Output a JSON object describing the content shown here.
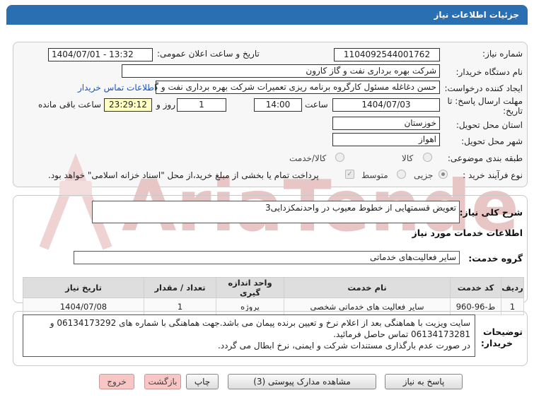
{
  "header": {
    "title": "جزئیات اطلاعات نیاز"
  },
  "form": {
    "need_number_label": "شماره نیاز:",
    "need_number": "1104092544001762",
    "announce_label": "تاریخ و ساعت اعلان عمومی:",
    "announce_value": "1404/07/01 - 13:32",
    "buyer_label": "نام دستگاه خریدار:",
    "buyer_value": "شرکت بهره برداری نفت و گاز کارون",
    "creator_label": "ایجاد کننده درخواست:",
    "creator_value": "حسن دغاغله مسئول کارگروه برنامه ریزی تعمیرات شرکت بهره برداری نفت و گاز",
    "contact_link": "اطلاعات تماس خریدار",
    "deadline_label_line1": "مهلت ارسال پاسخ: تا",
    "deadline_label_line2": "تاریخ:",
    "deadline_date": "1404/07/03",
    "time_label": "ساعت",
    "deadline_time": "14:00",
    "days_value": "1",
    "days_label": "روز و",
    "remaining_time": "23:29:12",
    "remaining_label": "ساعت باقی مانده",
    "province_label": "استان محل تحویل:",
    "province_value": "خوزستان",
    "city_label": "شهر محل تحویل:",
    "city_value": "اهواز",
    "category_label": "طبقه بندی موضوعی:",
    "category_options": [
      "کالا",
      "کالا/خدمت"
    ],
    "process_label": "نوع فرآیند خرید :",
    "process_options": [
      "جزیی",
      "متوسط"
    ],
    "payment_note": "پرداخت تمام یا بخشی از مبلغ خرید،از محل \"اسناد خزانه اسلامی\" خواهد بود."
  },
  "summary": {
    "label": "شرح کلی نیاز:",
    "value": "تعویض قسمتهایی از خطوط معیوب در واحدنمکزدایی3"
  },
  "services": {
    "section_title": "اطلاعات خدمات مورد نیاز",
    "group_label": "گروه خدمت:",
    "group_value": "سایر فعالیت‌های خدماتی"
  },
  "table": {
    "headers": [
      "ردیف",
      "کد خدمت",
      "نام خدمت",
      "واحد اندازه گیری",
      "تعداد / مقدار",
      "تاریخ نیاز"
    ],
    "rows": [
      [
        "1",
        "ط-96-960",
        "سایر فعالیت های خدماتی شخصی",
        "پروژه",
        "1",
        "1404/07/08"
      ]
    ]
  },
  "notes": {
    "label_line1": "توضیحات",
    "label_line2": "خریدار:",
    "line1": "سایت ویزیت با هماهنگی بعد از اعلام نرخ و تعیین برنده پیمان می باشد.جهت هماهنگی با شماره های  06134173292 و",
    "line2": "06134173281 تماس حاصل فرمائید.",
    "line3": "در صورت عدم بارگذاری مستندات شرکت و ایمنی، نرخ ابطال می گردد."
  },
  "buttons": {
    "reply": "پاسخ به نیاز",
    "attachments": "مشاهده مدارک پیوستی (3)",
    "print": "چاپ",
    "back": "بازگشت",
    "exit": "خروج"
  },
  "watermark": {
    "text": "AriaTender.net",
    "color": "#e9c6c6"
  }
}
